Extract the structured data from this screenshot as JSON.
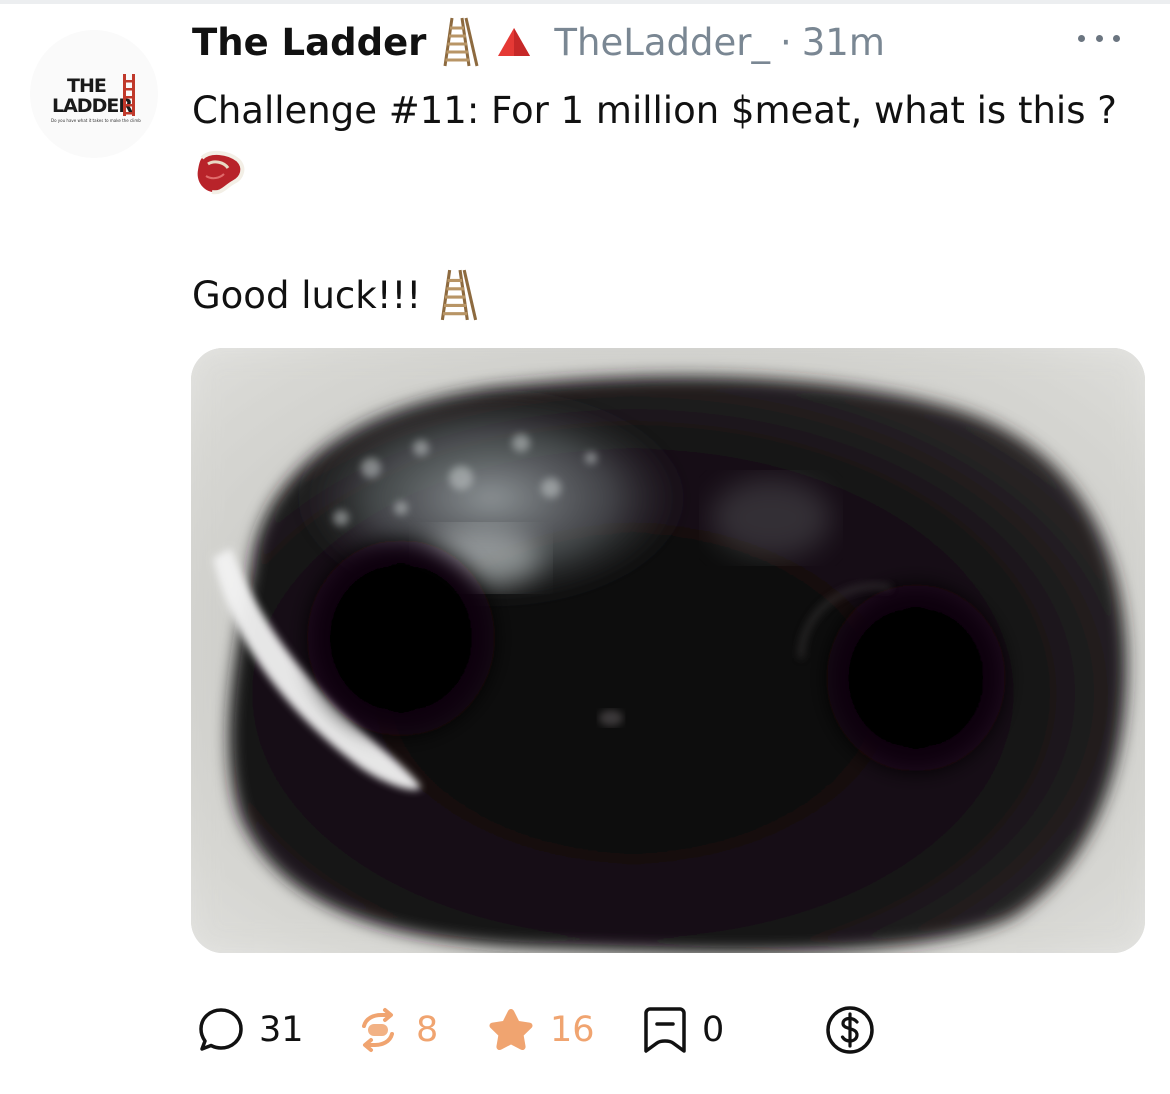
{
  "post": {
    "avatar": {
      "line1": "THE",
      "line2": "LADDER",
      "tagline": "Do you have what it takes to make the climb?"
    },
    "display_name": "The Ladder",
    "handle": "TheLadder_",
    "separator": "·",
    "time": "31m",
    "text_line1": "Challenge #11: For 1 million $meat, what is this ?",
    "text_line2": "Good luck!!!",
    "badge_icons": [
      "ladder-emoji",
      "red-triangle-emoji"
    ],
    "inline_icons": [
      "steak-emoji",
      "ladder-emoji"
    ]
  },
  "actions": {
    "replies": "31",
    "recasts": "8",
    "likes": "16",
    "bookmarks": "0"
  },
  "colors": {
    "handle": "#7a8793",
    "accent": "#f0a470",
    "text": "#111111",
    "triangle": "#e53935"
  }
}
